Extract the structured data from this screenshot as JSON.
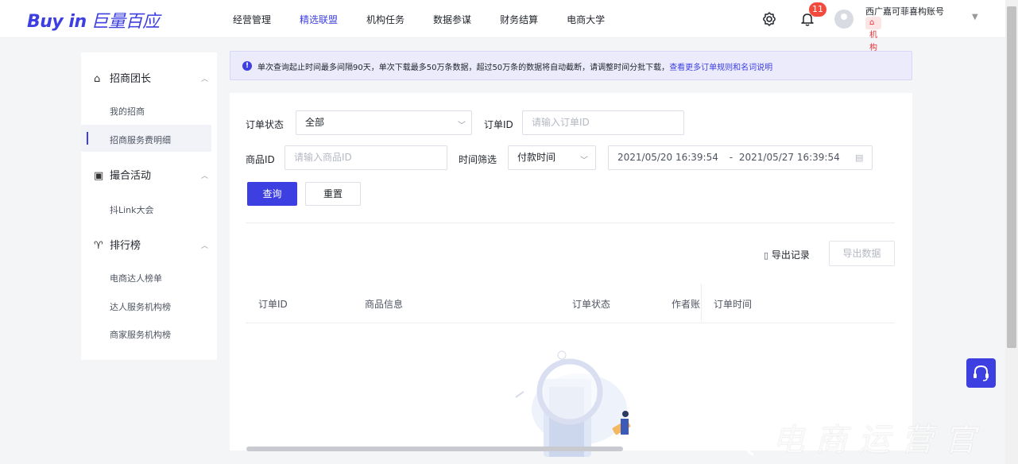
{
  "header": {
    "logo_latin": "Buy in",
    "logo_cn": "巨量百应",
    "nav": [
      {
        "label": "经营管理",
        "active": false
      },
      {
        "label": "精选联盟",
        "active": true
      },
      {
        "label": "机构任务",
        "active": false
      },
      {
        "label": "数据参谋",
        "active": false
      },
      {
        "label": "财务结算",
        "active": false
      },
      {
        "label": "电商大学",
        "active": false
      }
    ],
    "notification_count": "11",
    "account_name": "西广嘉可菲喜构账号",
    "account_tag": "机构"
  },
  "sidebar": {
    "groups": [
      {
        "label": "招商团长",
        "icon": "bag-icon",
        "items": [
          "我的招商",
          "招商服务费明细"
        ]
      },
      {
        "label": "撮合活动",
        "icon": "calendar-icon",
        "items": [
          "抖Link大会"
        ]
      },
      {
        "label": "排行榜",
        "icon": "trophy-icon",
        "items": [
          "电商达人榜单",
          "达人服务机构榜",
          "商家服务机构榜"
        ]
      }
    ],
    "active_item": "招商服务费明细"
  },
  "alert": {
    "text": "单次查询起止时间最多间隔90天，单次下载最多50万条数据，超过50万条的数据将自动截断，请调整时间分批下载，",
    "link": "查看更多订单规则和名词说明"
  },
  "filters": {
    "order_status_label": "订单状态",
    "order_status_value": "全部",
    "order_id_label": "订单ID",
    "order_id_placeholder": "请输入订单ID",
    "product_id_label": "商品ID",
    "product_id_placeholder": "请输入商品ID",
    "time_filter_label": "时间筛选",
    "time_filter_value": "付款时间",
    "date_start": "2021/05/20 16:39:54",
    "date_sep": "-",
    "date_end": "2021/05/27 16:39:54",
    "query_label": "查询",
    "reset_label": "重置"
  },
  "toolbar": {
    "export_records": "导出记录",
    "export_data": "导出数据"
  },
  "table": {
    "columns": [
      "订单ID",
      "商品信息",
      "订单状态",
      "作者账",
      "订单时间"
    ]
  },
  "watermark": "电商运营官",
  "colors": {
    "brand": "#3d3fe0",
    "badge": "#f24a3c",
    "alert_bg": "#ebebfc"
  }
}
